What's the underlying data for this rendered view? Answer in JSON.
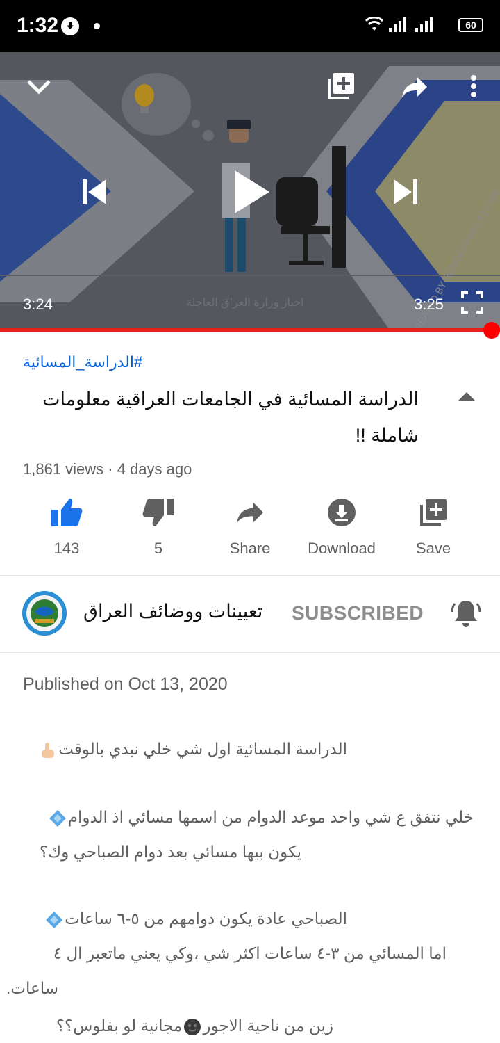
{
  "status": {
    "time": "1:32",
    "battery": "60"
  },
  "player": {
    "current_time": "3:24",
    "duration": "3:25",
    "progress": 0.995,
    "overlay_text": "اخبار وزارة العراق العاجلة",
    "watermark": "CREATED BY RENDERFOREST.COM"
  },
  "video": {
    "hashtag": "#الدراسة_المسائية",
    "title_line1": "الدراسة المسائية في الجامعات العراقية معلومات",
    "title_line2": "شاملة !!",
    "meta": "1,861 views · 4 days ago"
  },
  "actions": {
    "like": "143",
    "dislike": "5",
    "share": "Share",
    "download": "Download",
    "save": "Save"
  },
  "channel": {
    "name": "تعيينات ووضائف العراق",
    "subscribe_state": "SUBSCRIBED"
  },
  "description": {
    "published": "Published on Oct 13, 2020",
    "line1": "الدراسة المسائية اول شي خلي نبدي بالوقت",
    "line2": "خلي نتفق ع شي واحد موعد الدوام من اسمها مسائي اذ الدوام",
    "line3": "يكون بيها مسائي بعد دوام الصباحي وك؟",
    "line4": "الصباحي عادة يكون دوامهم من ٥-٦ ساعات",
    "line5": "اما المسائي من ٣-٤ ساعات اكثر شي ،وكي يعني ماتعبر ال ٤",
    "line6": "ساعات.",
    "line7": "زين من ناحية الاجور",
    "line7b": "مجانية لو بفلوس؟؟"
  },
  "colors": {
    "accent_blue": "#065fd4",
    "like_blue": "#1a73e8",
    "progress_red": "#ff0000"
  }
}
